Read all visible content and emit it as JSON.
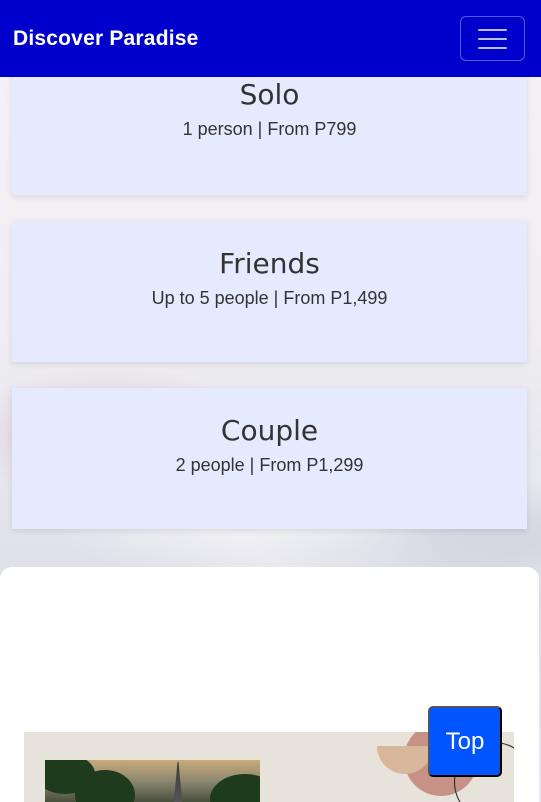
{
  "navbar": {
    "brand": "Discover Paradise",
    "toggle_icon": "hamburger-menu-icon",
    "color": "#0000cc"
  },
  "packages": [
    {
      "title": "Solo",
      "detail": "1 person | From P799"
    },
    {
      "title": "Friends",
      "detail": "Up to 5 people | From P1,499"
    },
    {
      "title": "Couple",
      "detail": "2 people | From P1,299"
    }
  ],
  "scroll_top": {
    "label": "Top",
    "color": "#0055ff"
  },
  "colors": {
    "card_bg": "#e6eaff",
    "text": "#333333"
  }
}
